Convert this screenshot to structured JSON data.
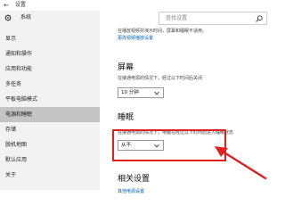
{
  "window": {
    "back_glyph": "←",
    "title": "设置"
  },
  "sidebar": {
    "title": "系统",
    "items": [
      {
        "label": "显示",
        "selected": false
      },
      {
        "label": "通知和操作",
        "selected": false
      },
      {
        "label": "应用和功能",
        "selected": false
      },
      {
        "label": "多任务",
        "selected": false
      },
      {
        "label": "平板电脑模式",
        "selected": false
      },
      {
        "label": "电源和睡眠",
        "selected": true
      },
      {
        "label": "存储",
        "selected": false
      },
      {
        "label": "脱机地图",
        "selected": false
      },
      {
        "label": "默认应用",
        "selected": false
      },
      {
        "label": "关于",
        "selected": false
      }
    ]
  },
  "search": {
    "placeholder": "查找设置"
  },
  "main": {
    "top_desc": "在播放视频并演示时间，屏幕和睡眠不适用。",
    "top_link": "更改视频播放设置",
    "screen": {
      "heading": "屏幕",
      "desc": "在接通电源的情况下，经过以下时间后关闭",
      "value": "10 分钟"
    },
    "sleep": {
      "heading": "睡眠",
      "desc": "在接通电源的情况下，电脑在经过以下时间后进入睡眠状态",
      "value": "从不"
    },
    "related": {
      "heading": "相关设置",
      "link": "其他电源设置"
    }
  },
  "annotation": {
    "color": "#e02020"
  },
  "colors": {
    "accent": "#0063b1",
    "sidebar_bg": "#f2f2f2",
    "selected_bg": "#c4c4c4"
  }
}
